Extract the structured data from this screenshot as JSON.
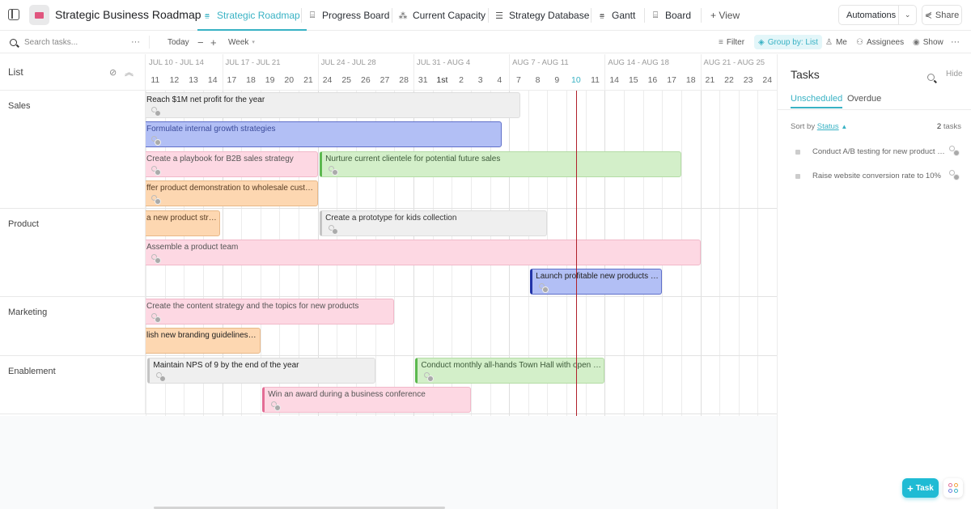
{
  "app": {
    "title": "Strategic Business Roadmap",
    "accent": "#38b2c4"
  },
  "tabs": [
    {
      "label": "Strategic Roadmap",
      "icon": "gantt-icon",
      "active": true
    },
    {
      "label": "Progress Board",
      "icon": "board-icon",
      "active": false
    },
    {
      "label": "Current Capacity",
      "icon": "workload-icon",
      "active": false
    },
    {
      "label": "Strategy Database",
      "icon": "list-icon",
      "active": false
    },
    {
      "label": "Gantt",
      "icon": "gantt-icon",
      "active": false
    },
    {
      "label": "Board",
      "icon": "board-icon",
      "active": false
    },
    {
      "label": "+ View",
      "icon": "plus-icon",
      "active": false
    }
  ],
  "header_actions": {
    "automations": "Automations",
    "share": "Share"
  },
  "toolbar": {
    "search_placeholder": "Search tasks...",
    "more": "···",
    "today": "Today",
    "zoom_out": "−",
    "zoom_in": "+",
    "scale": "Week",
    "filter": "Filter",
    "group_by": "Group by: List",
    "me": "Me",
    "assignees": "Assignees",
    "show": "Show",
    "more_right": "···"
  },
  "list_header": {
    "label": "List"
  },
  "timeline": {
    "weeks": [
      "JUL 10 - JUL 14",
      "JUL 17 - JUL 21",
      "JUL 24 - JUL 28",
      "JUL 31 - AUG 4",
      "AUG 7 - AUG 11",
      "AUG 14 - AUG 18",
      "AUG 21 - AUG 25"
    ],
    "days": [
      "11",
      "12",
      "13",
      "14",
      "17",
      "18",
      "19",
      "20",
      "21",
      "24",
      "25",
      "26",
      "27",
      "28",
      "31",
      "1st",
      "2",
      "3",
      "4",
      "7",
      "8",
      "9",
      "10",
      "11",
      "14",
      "15",
      "16",
      "17",
      "18",
      "21",
      "22",
      "23",
      "24"
    ],
    "today": "10",
    "today_index": 22
  },
  "groups": [
    {
      "name": "Sales",
      "tasks": [
        {
          "title": "Reach $1M net profit for the year",
          "color": "gray",
          "start": -1,
          "end": 19.6,
          "row": 0,
          "dark": true
        },
        {
          "title": "Formulate internal growth strategies",
          "color": "blue",
          "start": -1,
          "end": 18.6,
          "row": 1
        },
        {
          "title": "Create a playbook for B2B sales strategy",
          "color": "pink",
          "start": -1,
          "end": 9,
          "row": 2
        },
        {
          "title": "Nurture current clientele for potential future sales",
          "color": "green",
          "start": 9.1,
          "end": 28.0,
          "row": 2,
          "accent": "lg-green"
        },
        {
          "title": "ffer product demonstration to wholesale customers",
          "color": "orange",
          "start": -1,
          "end": 9,
          "row": 3
        }
      ]
    },
    {
      "name": "Product",
      "tasks": [
        {
          "title": "a new product strate...",
          "color": "orange",
          "start": -1,
          "end": 3.9,
          "row": 0,
          "no_assignee": true
        },
        {
          "title": "Create a prototype for kids collection",
          "color": "gray",
          "start": 9.1,
          "end": 21.0,
          "row": 0,
          "accent": "lg-gray"
        },
        {
          "title": "Assemble a product team",
          "color": "pink",
          "start": -1,
          "end": 29.0,
          "row": 1
        },
        {
          "title": "Launch profitable new products wi...",
          "color": "blue",
          "start": 20.1,
          "end": 27.0,
          "row": 2,
          "accent": "lg-blue",
          "dark": true
        }
      ]
    },
    {
      "name": "Marketing",
      "tasks": [
        {
          "title": "Create the content strategy and the topics for new products",
          "color": "pink",
          "start": -1,
          "end": 13.0,
          "row": 0
        },
        {
          "title": "lish new branding guidelines f...",
          "color": "orange",
          "start": -1,
          "end": 6.0,
          "row": 1,
          "no_assignee": true,
          "dark": true
        }
      ]
    },
    {
      "name": "Enablement",
      "tasks": [
        {
          "title": "Maintain NPS of 9 by the end of the year",
          "color": "gray",
          "start": 0.1,
          "end": 12.0,
          "row": 0,
          "accent": "lg-gray",
          "dark": true
        },
        {
          "title": "Conduct monthly all-hands Town Hall with open Q&...",
          "color": "green",
          "start": 14.1,
          "end": 24.0,
          "row": 0,
          "accent": "lg-green"
        },
        {
          "title": "Win an award during a business conference",
          "color": "pink",
          "start": 6.1,
          "end": 17.0,
          "row": 1,
          "accent": "lg-pink"
        }
      ]
    }
  ],
  "panel": {
    "title": "Tasks",
    "hide": "Hide",
    "tabs": [
      "Unscheduled",
      "Overdue"
    ],
    "sort_by_label": "Sort by",
    "sort_field": "Status",
    "count_num": "2",
    "count_label": "tasks",
    "tasks": [
      "Conduct A/B testing for new product p...",
      "Raise website conversion rate to 10%"
    ]
  },
  "fab": {
    "task": "Task"
  }
}
